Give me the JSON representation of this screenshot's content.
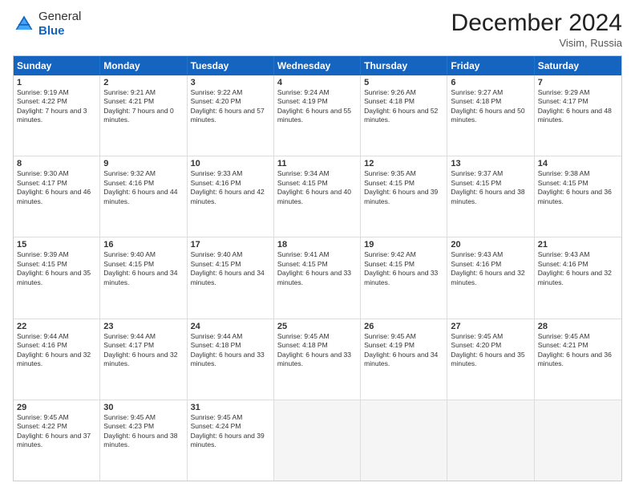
{
  "logo": {
    "general": "General",
    "blue": "Blue"
  },
  "title": "December 2024",
  "subtitle": "Visim, Russia",
  "days": [
    "Sunday",
    "Monday",
    "Tuesday",
    "Wednesday",
    "Thursday",
    "Friday",
    "Saturday"
  ],
  "weeks": [
    [
      {
        "day": "1",
        "rise": "9:19 AM",
        "set": "4:22 PM",
        "daylight": "7 hours and 3 minutes."
      },
      {
        "day": "2",
        "rise": "9:21 AM",
        "set": "4:21 PM",
        "daylight": "7 hours and 0 minutes."
      },
      {
        "day": "3",
        "rise": "9:22 AM",
        "set": "4:20 PM",
        "daylight": "6 hours and 57 minutes."
      },
      {
        "day": "4",
        "rise": "9:24 AM",
        "set": "4:19 PM",
        "daylight": "6 hours and 55 minutes."
      },
      {
        "day": "5",
        "rise": "9:26 AM",
        "set": "4:18 PM",
        "daylight": "6 hours and 52 minutes."
      },
      {
        "day": "6",
        "rise": "9:27 AM",
        "set": "4:18 PM",
        "daylight": "6 hours and 50 minutes."
      },
      {
        "day": "7",
        "rise": "9:29 AM",
        "set": "4:17 PM",
        "daylight": "6 hours and 48 minutes."
      }
    ],
    [
      {
        "day": "8",
        "rise": "9:30 AM",
        "set": "4:17 PM",
        "daylight": "6 hours and 46 minutes."
      },
      {
        "day": "9",
        "rise": "9:32 AM",
        "set": "4:16 PM",
        "daylight": "6 hours and 44 minutes."
      },
      {
        "day": "10",
        "rise": "9:33 AM",
        "set": "4:16 PM",
        "daylight": "6 hours and 42 minutes."
      },
      {
        "day": "11",
        "rise": "9:34 AM",
        "set": "4:15 PM",
        "daylight": "6 hours and 40 minutes."
      },
      {
        "day": "12",
        "rise": "9:35 AM",
        "set": "4:15 PM",
        "daylight": "6 hours and 39 minutes."
      },
      {
        "day": "13",
        "rise": "9:37 AM",
        "set": "4:15 PM",
        "daylight": "6 hours and 38 minutes."
      },
      {
        "day": "14",
        "rise": "9:38 AM",
        "set": "4:15 PM",
        "daylight": "6 hours and 36 minutes."
      }
    ],
    [
      {
        "day": "15",
        "rise": "9:39 AM",
        "set": "4:15 PM",
        "daylight": "6 hours and 35 minutes."
      },
      {
        "day": "16",
        "rise": "9:40 AM",
        "set": "4:15 PM",
        "daylight": "6 hours and 34 minutes."
      },
      {
        "day": "17",
        "rise": "9:40 AM",
        "set": "4:15 PM",
        "daylight": "6 hours and 34 minutes."
      },
      {
        "day": "18",
        "rise": "9:41 AM",
        "set": "4:15 PM",
        "daylight": "6 hours and 33 minutes."
      },
      {
        "day": "19",
        "rise": "9:42 AM",
        "set": "4:15 PM",
        "daylight": "6 hours and 33 minutes."
      },
      {
        "day": "20",
        "rise": "9:43 AM",
        "set": "4:16 PM",
        "daylight": "6 hours and 32 minutes."
      },
      {
        "day": "21",
        "rise": "9:43 AM",
        "set": "4:16 PM",
        "daylight": "6 hours and 32 minutes."
      }
    ],
    [
      {
        "day": "22",
        "rise": "9:44 AM",
        "set": "4:16 PM",
        "daylight": "6 hours and 32 minutes."
      },
      {
        "day": "23",
        "rise": "9:44 AM",
        "set": "4:17 PM",
        "daylight": "6 hours and 32 minutes."
      },
      {
        "day": "24",
        "rise": "9:44 AM",
        "set": "4:18 PM",
        "daylight": "6 hours and 33 minutes."
      },
      {
        "day": "25",
        "rise": "9:45 AM",
        "set": "4:18 PM",
        "daylight": "6 hours and 33 minutes."
      },
      {
        "day": "26",
        "rise": "9:45 AM",
        "set": "4:19 PM",
        "daylight": "6 hours and 34 minutes."
      },
      {
        "day": "27",
        "rise": "9:45 AM",
        "set": "4:20 PM",
        "daylight": "6 hours and 35 minutes."
      },
      {
        "day": "28",
        "rise": "9:45 AM",
        "set": "4:21 PM",
        "daylight": "6 hours and 36 minutes."
      }
    ],
    [
      {
        "day": "29",
        "rise": "9:45 AM",
        "set": "4:22 PM",
        "daylight": "6 hours and 37 minutes."
      },
      {
        "day": "30",
        "rise": "9:45 AM",
        "set": "4:23 PM",
        "daylight": "6 hours and 38 minutes."
      },
      {
        "day": "31",
        "rise": "9:45 AM",
        "set": "4:24 PM",
        "daylight": "6 hours and 39 minutes."
      },
      null,
      null,
      null,
      null
    ]
  ]
}
